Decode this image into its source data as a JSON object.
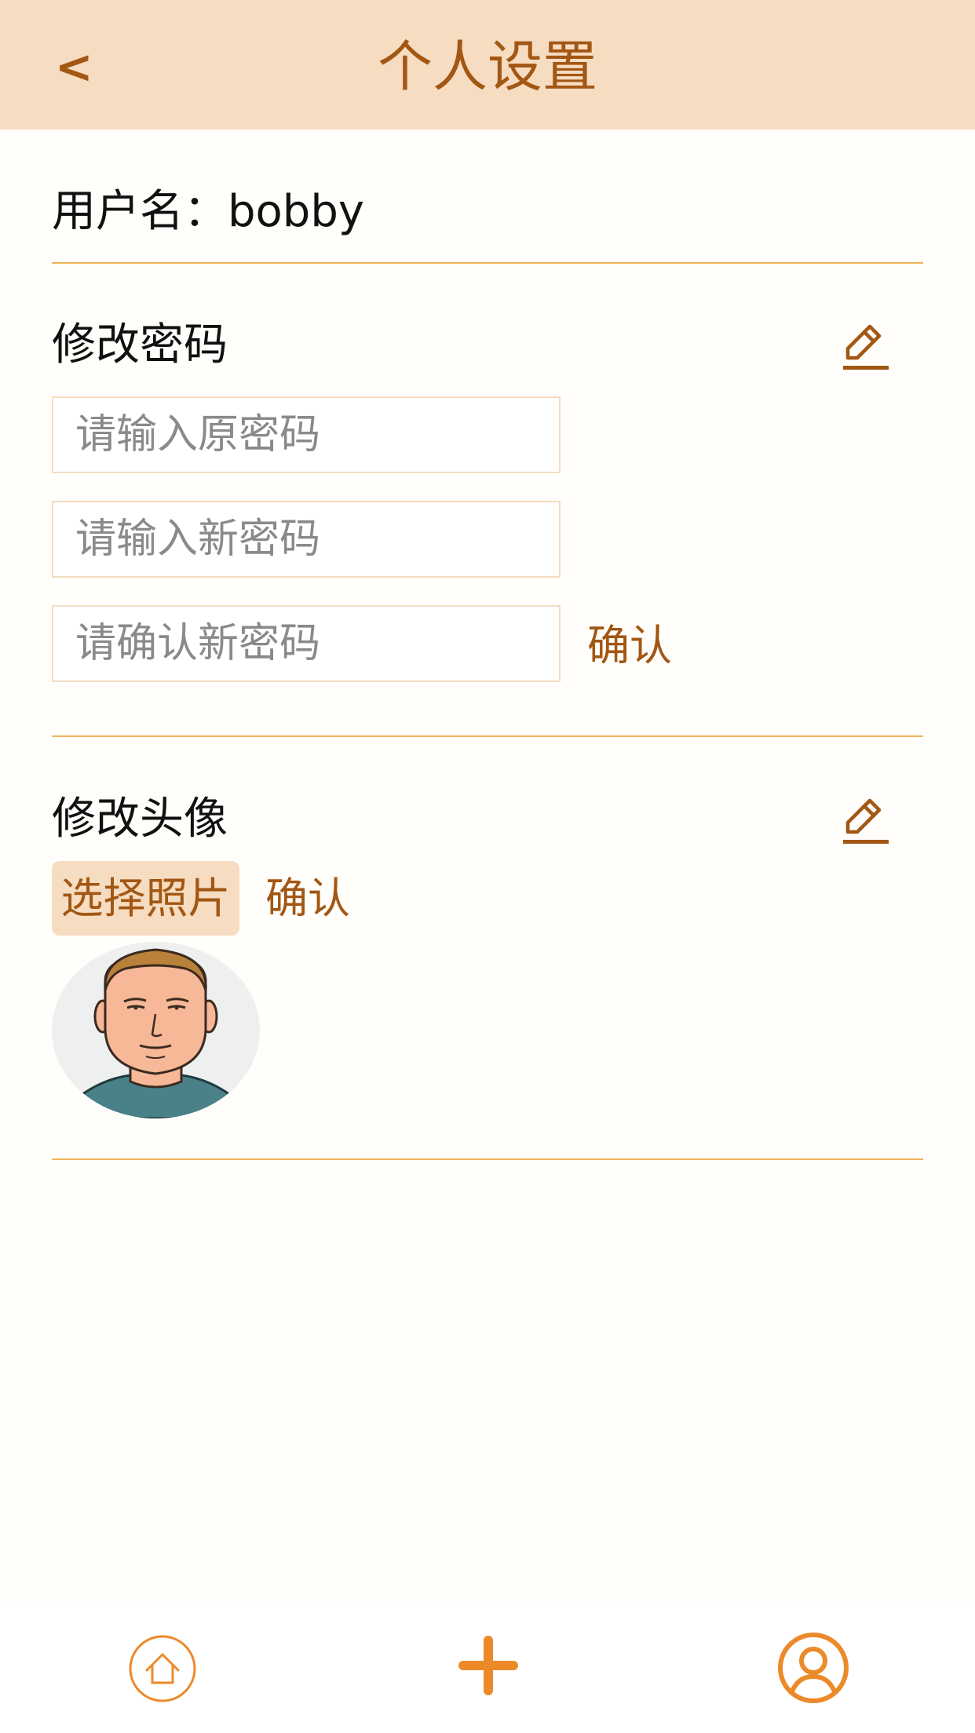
{
  "header": {
    "back_label": "<",
    "title": "个人设置"
  },
  "profile": {
    "username_label": "用户名：",
    "username_value": "bobby"
  },
  "password_section": {
    "title": "修改密码",
    "edit_icon": "pencil-icon",
    "old_placeholder": "请输入原密码",
    "new_placeholder": "请输入新密码",
    "confirm_placeholder": "请确认新密码",
    "confirm_label": "确认"
  },
  "avatar_section": {
    "title": "修改头像",
    "edit_icon": "pencil-icon",
    "choose_label": "选择照片",
    "confirm_label": "确认"
  },
  "tabbar": {
    "items": [
      {
        "icon": "home-icon"
      },
      {
        "icon": "plus-icon"
      },
      {
        "icon": "user-icon"
      }
    ]
  },
  "colors": {
    "accent": "#a25713",
    "header_bg": "#f6dcc1",
    "divider": "#efb35b",
    "tab_orange": "#ec8a2a"
  }
}
